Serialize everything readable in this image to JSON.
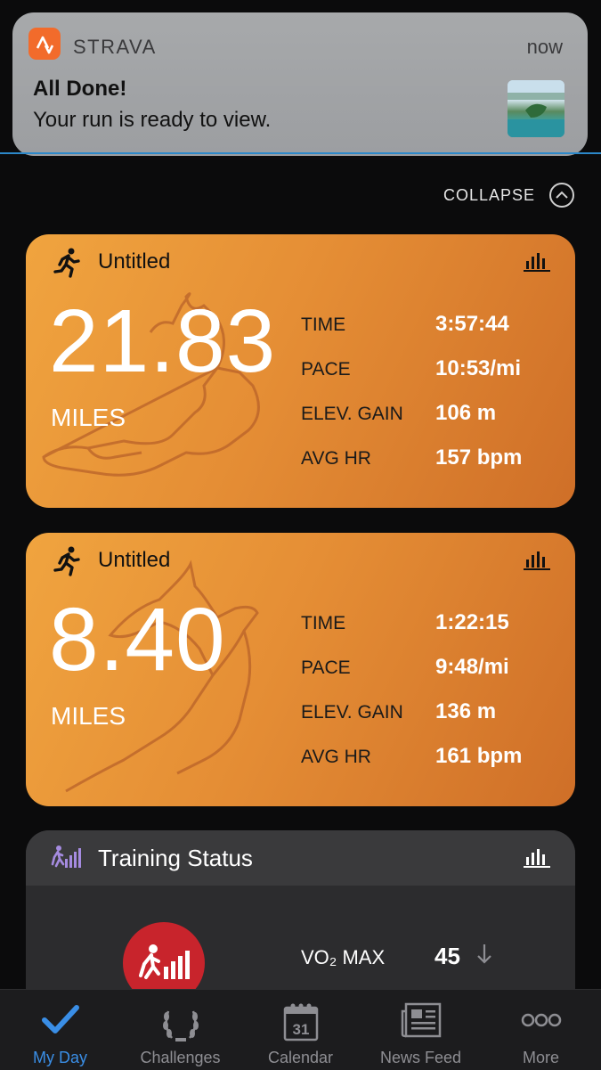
{
  "notification": {
    "app_name": "STRAVA",
    "time": "now",
    "title": "All Done!",
    "body": "Your run is ready to view.",
    "accent_color": "#f26b2b"
  },
  "collapse_label": "COLLAPSE",
  "activities": [
    {
      "title": "Untitled",
      "distance": "21.83",
      "unit": "MILES",
      "stats": [
        {
          "label": "TIME",
          "value": "3:57:44"
        },
        {
          "label": "PACE",
          "value": "10:53/mi"
        },
        {
          "label": "ELEV. GAIN",
          "value": "106 m"
        },
        {
          "label": "AVG HR",
          "value": "157 bpm"
        }
      ]
    },
    {
      "title": "Untitled",
      "distance": "8.40",
      "unit": "MILES",
      "stats": [
        {
          "label": "TIME",
          "value": "1:22:15"
        },
        {
          "label": "PACE",
          "value": "9:48/mi"
        },
        {
          "label": "ELEV. GAIN",
          "value": "136 m"
        },
        {
          "label": "AVG HR",
          "value": "161 bpm"
        }
      ]
    }
  ],
  "training_status": {
    "title": "Training Status",
    "vo2_label": "VO₂ MAX",
    "vo2_value": "45",
    "badge_color": "#c8242c"
  },
  "tabs": [
    {
      "label": "My Day",
      "icon": "check-icon",
      "active": true
    },
    {
      "label": "Challenges",
      "icon": "laurel-icon",
      "active": false
    },
    {
      "label": "Calendar",
      "icon": "calendar-icon",
      "calendar_day": "31",
      "active": false
    },
    {
      "label": "News Feed",
      "icon": "newspaper-icon",
      "active": false
    },
    {
      "label": "More",
      "icon": "more-icon",
      "active": false
    }
  ]
}
